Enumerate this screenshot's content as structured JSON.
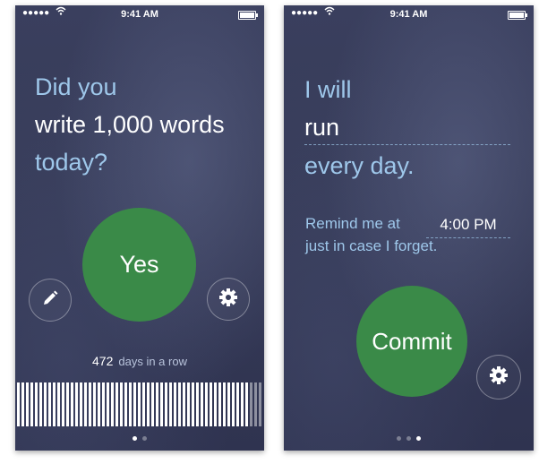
{
  "status_bar": {
    "signal": "●●●●●",
    "time": "9:41 AM"
  },
  "screen_check_in": {
    "question_line1": "Did you",
    "question_line2": "write 1,000 words",
    "question_line3": "today?",
    "yes_button": "Yes",
    "streak_count": "472",
    "streak_label": "days in a row",
    "edit_icon": "pencil-icon",
    "settings_icon": "gear-icon",
    "page_indicator": {
      "pages": 2,
      "active": 1
    }
  },
  "screen_setup": {
    "line1": "I will",
    "habit_value": "run",
    "line3": "every day.",
    "remind_prefix": "Remind me at",
    "remind_time": "4:00 PM",
    "remind_suffix": "just in case I forget.",
    "commit_button": "Commit",
    "settings_icon": "gear-icon",
    "page_indicator": {
      "pages": 3,
      "active": 3
    }
  },
  "colors": {
    "background": "#363b58",
    "accent_text": "#9ec7ea",
    "button_green": "#3a8a48",
    "text": "#ffffff"
  }
}
